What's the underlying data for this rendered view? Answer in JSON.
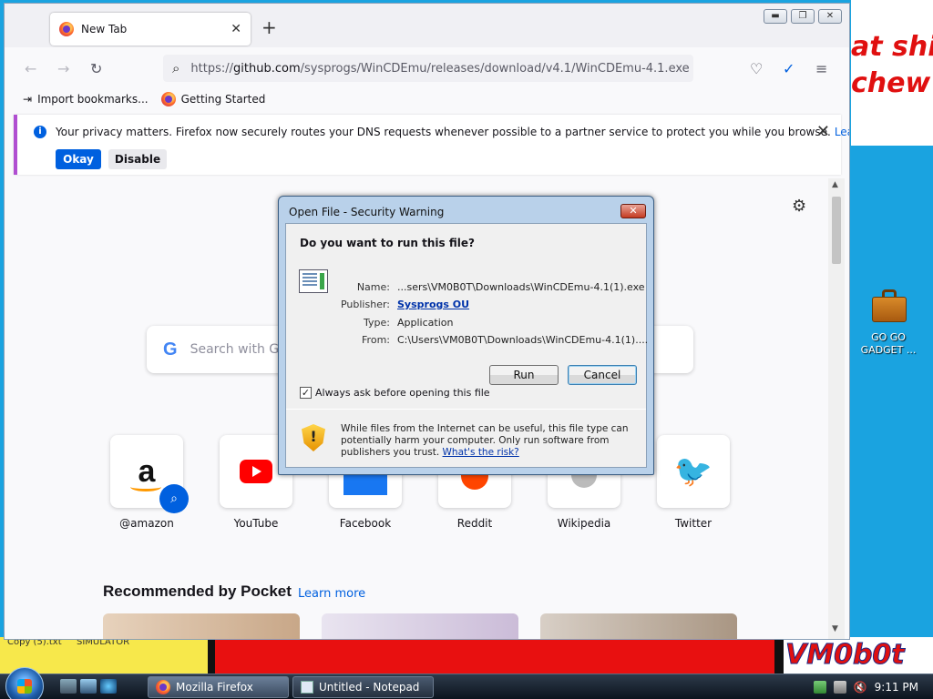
{
  "desktop": {
    "wall_text_1": "at shit",
    "wall_text_2": "chew",
    "wall_signature": "VM0b0t",
    "bottom_labels": [
      "Copy (5).txt",
      "SIMULATOR"
    ],
    "icon": {
      "name": "briefcase-icon",
      "label_line1": "GO GO",
      "label_line2": "GADGET ..."
    }
  },
  "browser": {
    "tab": {
      "title": "New Tab"
    },
    "window_buttons": {
      "minimize": "▬",
      "restore": "❐",
      "close": "✕"
    },
    "url": {
      "prefix": "https://",
      "domain": "github.com",
      "path": "/sysprogs/WinCDEmu/releases/download/v4.1/WinCDEmu-4.1.exe"
    },
    "bookmarks": [
      {
        "label": "Import bookmarks...",
        "icon": "import-icon"
      },
      {
        "label": "Getting Started",
        "icon": "firefox-icon"
      }
    ],
    "notice": {
      "message": "Your privacy matters. Firefox now securely routes your DNS requests whenever possible to a partner service to protect you while you browse.",
      "learn_more": "Learn more",
      "okay": "Okay",
      "disable": "Disable"
    },
    "newtab": {
      "search_placeholder": "Search with G",
      "tiles": [
        {
          "label": "@amazon",
          "icon": "amazon-icon"
        },
        {
          "label": "YouTube",
          "icon": "youtube-icon"
        },
        {
          "label": "Facebook",
          "icon": "facebook-icon"
        },
        {
          "label": "Reddit",
          "icon": "reddit-icon"
        },
        {
          "label": "Wikipedia",
          "icon": "wikipedia-icon"
        },
        {
          "label": "Twitter",
          "icon": "twitter-icon"
        }
      ],
      "pocket_title": "Recommended by Pocket",
      "pocket_link": "Learn more"
    }
  },
  "dialog": {
    "title": "Open File - Security Warning",
    "close_glyph": "✕",
    "question": "Do you want to run this file?",
    "fields": {
      "name_label": "Name:",
      "name_value": "...sers\\VM0B0T\\Downloads\\WinCDEmu-4.1(1).exe",
      "publisher_label": "Publisher:",
      "publisher_value": "Sysprogs OU",
      "type_label": "Type:",
      "type_value": "Application",
      "from_label": "From:",
      "from_value": "C:\\Users\\VM0B0T\\Downloads\\WinCDEmu-4.1(1)...."
    },
    "run": "Run",
    "cancel": "Cancel",
    "always_ask": "Always ask before opening this file",
    "always_ask_checked": true,
    "warning": "While files from the Internet can be useful, this file type can potentially harm your computer. Only run software from publishers you trust.",
    "risk_link": "What's the risk?"
  },
  "taskbar": {
    "buttons": [
      {
        "label": "Mozilla Firefox",
        "active": true
      },
      {
        "label": "Untitled - Notepad",
        "active": false
      }
    ],
    "clock": "9:11 PM"
  },
  "colors": {
    "firefox_blue": "#0060df",
    "desktop_blue": "#1aa3e0",
    "wall_red": "#e81010"
  }
}
